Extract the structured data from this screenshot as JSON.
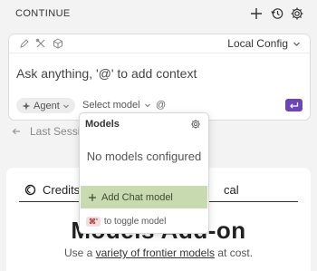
{
  "header": {
    "title": "CONTINUE",
    "icons": [
      "plus-icon",
      "history-icon",
      "gear-icon"
    ]
  },
  "input_card": {
    "toolbar_icons": [
      "pencil-icon",
      "tools-icon",
      "cube-icon"
    ],
    "config_label": "Local Config",
    "prompt_placeholder": "Ask anything, '@' to add context",
    "agent_label": "Agent",
    "select_model_label": "Select model",
    "at_label": "@"
  },
  "last_session": {
    "label": "Last Sessio"
  },
  "panel": {
    "tabs": [
      {
        "label": "Credits"
      },
      {
        "label": "cal"
      }
    ],
    "heading": "Models Add-on",
    "subtext_prefix": "Use a ",
    "subtext_link": "variety of frontier models",
    "subtext_suffix": " at cost."
  },
  "models_dropdown": {
    "title": "Models",
    "empty_text": "No models configured",
    "add_label": "Add Chat model",
    "shortcut": "⌘'",
    "hint": "to toggle model"
  },
  "colors": {
    "accent": "#6b46b8",
    "highlight": "#c8dbb0",
    "background": "#f3f3f3"
  }
}
